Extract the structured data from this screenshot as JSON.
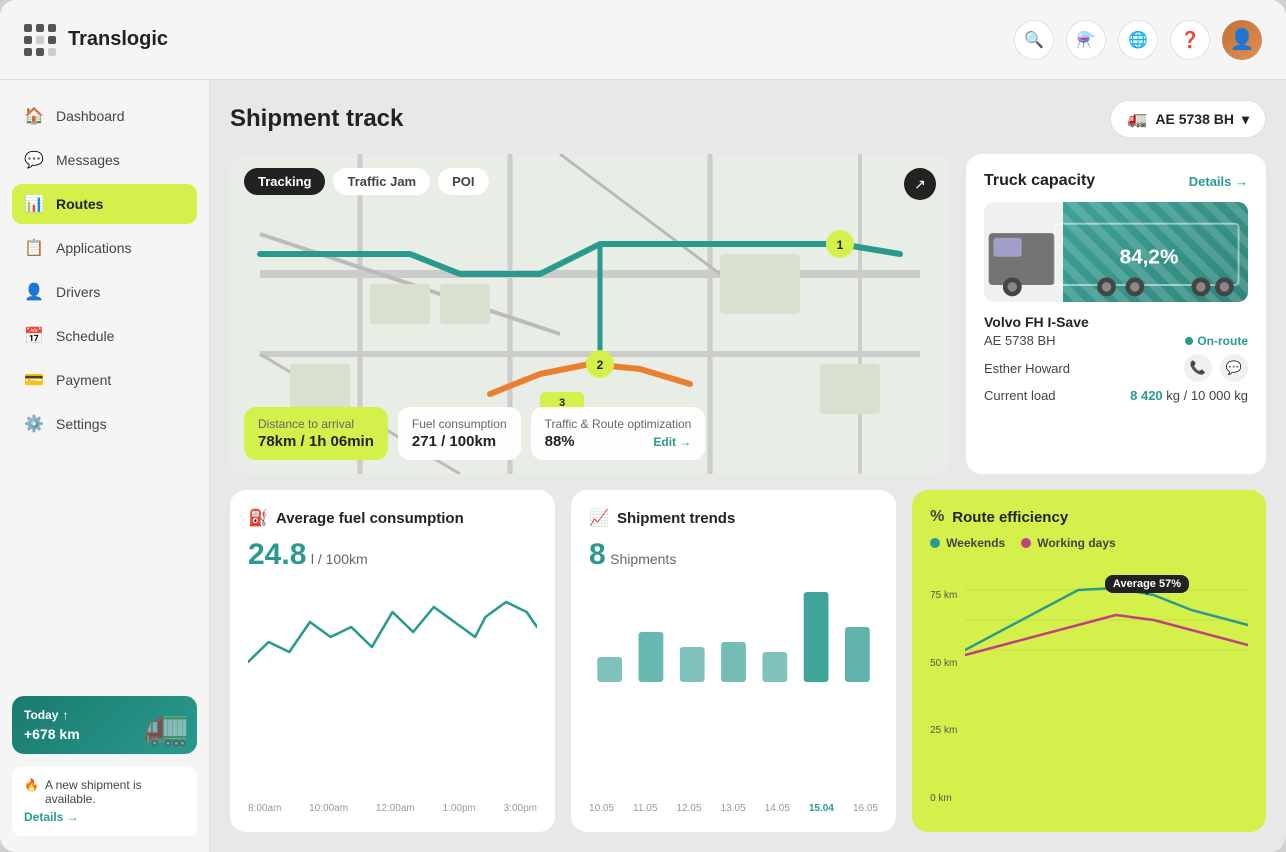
{
  "app": {
    "name": "Translogic"
  },
  "topbar": {
    "icons": [
      "search",
      "filter",
      "globe",
      "help"
    ],
    "vehicle_id": "AE 5738 BH"
  },
  "sidebar": {
    "items": [
      {
        "id": "dashboard",
        "label": "Dashboard",
        "icon": "🏠"
      },
      {
        "id": "messages",
        "label": "Messages",
        "icon": "💬"
      },
      {
        "id": "routes",
        "label": "Routes",
        "icon": "📊",
        "active": true
      },
      {
        "id": "applications",
        "label": "Applications",
        "icon": "📋"
      },
      {
        "id": "drivers",
        "label": "Drivers",
        "icon": "👤"
      },
      {
        "id": "schedule",
        "label": "Schedule",
        "icon": "📅"
      },
      {
        "id": "payment",
        "label": "Payment",
        "icon": "💳"
      },
      {
        "id": "settings",
        "label": "Settings",
        "icon": "⚙️"
      }
    ],
    "today_card": {
      "label": "Today",
      "km": "+678 km"
    },
    "new_shipment": {
      "text": "A new shipment is available.",
      "details_label": "Details →"
    }
  },
  "page": {
    "title": "Shipment track"
  },
  "map": {
    "tabs": [
      {
        "label": "Tracking",
        "active": true
      },
      {
        "label": "Traffic Jam",
        "active": false
      },
      {
        "label": "POI",
        "active": false
      }
    ],
    "waypoints": [
      "1",
      "2",
      "3"
    ],
    "info_cards": [
      {
        "id": "distance",
        "label": "Distance to arrival",
        "value": "78km / 1h 06min",
        "highlight": true
      },
      {
        "id": "fuel",
        "label": "Fuel consumption",
        "value": "271 / 100km",
        "highlight": false
      },
      {
        "id": "traffic",
        "label": "Traffic & Route optimization",
        "value": "88%",
        "edit_label": "Edit →",
        "highlight": false
      }
    ]
  },
  "truck_capacity": {
    "title": "Truck capacity",
    "details_label": "Details →",
    "percentage": "84,2%",
    "truck_model": "Volvo FH I-Save",
    "plate": "AE 5738 BH",
    "status": "On-route",
    "driver": "Esther Howard",
    "load_label": "Current load",
    "current_load": "8 420",
    "max_load": "10 000",
    "load_unit": "kg"
  },
  "fuel_card": {
    "icon": "⛽",
    "title": "Average fuel consumption",
    "value": "24.8",
    "unit": "l / 100km",
    "x_labels": [
      "8:00am",
      "10:00am",
      "12:00am",
      "1:00pm",
      "3:00pm"
    ]
  },
  "shipment_card": {
    "icon": "📈",
    "title": "Shipment trends",
    "count": "8",
    "label": "Shipments",
    "x_labels": [
      "10.05",
      "11.05",
      "12.05",
      "13.05",
      "14.05",
      "15.04",
      "16.05"
    ]
  },
  "route_card": {
    "icon": "%",
    "title": "Route efficiency",
    "legend": [
      {
        "label": "Weekends",
        "color": "#2a9a8e"
      },
      {
        "label": "Working days",
        "color": "#c04080"
      }
    ],
    "y_labels": [
      "75 km",
      "50 km",
      "25 km",
      "0 km"
    ],
    "avg_tooltip": "Average 57%"
  }
}
